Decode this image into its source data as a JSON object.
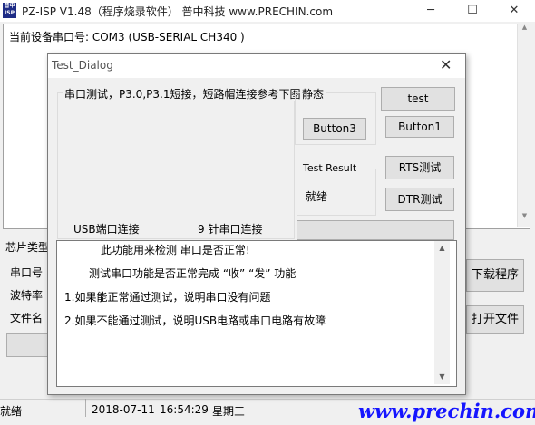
{
  "window": {
    "app_icon_text": "普中\nISP",
    "title": "PZ-ISP V1.48（程序烧录软件）  普中科技  www.PRECHIN.com",
    "minimize": "─",
    "maximize": "☐",
    "close": "✕"
  },
  "port": {
    "label": "当前设备串口号:  COM3 (USB-SERIAL CH340 )"
  },
  "left_panel": {
    "chip_type": "芯片类型",
    "serial": "串口号",
    "baud": "波特率",
    "filename": "文件名"
  },
  "buttons": {
    "download": "下载程序",
    "open_file": "打开文件"
  },
  "status": {
    "state": "就绪",
    "date": "2018-07-11",
    "time": "16:54:29",
    "weekday": "星期三",
    "brand": "www.prechin.com"
  },
  "dialog": {
    "title": "Test_Dialog",
    "close": "✕",
    "serial_group_label": "串口测试，P3.0,P3.1短接，短路帽连接参考下图",
    "usb_label": "USB端口连接",
    "nine_pin_label": "9 针串口连接",
    "static_group": "静态",
    "button3": "Button3",
    "test_btn": "test",
    "button1": "Button1",
    "rts_btn": "RTS测试",
    "dtr_btn": "DTR测试",
    "result_group": "Test Result",
    "result_value": "就绪",
    "messages": [
      "此功能用来检测 串口是否正常!",
      "测试串口功能是否正常完成  “收”  “发”  功能",
      "1.如果能正常通过测试，说明串口没有问题",
      "2.如果不能通过测试，说明USB电路或串口电路有故障"
    ]
  },
  "colors": {
    "brand": "#1515ff",
    "focus": "#0078d7",
    "icon_bg": "#1e2c86"
  }
}
